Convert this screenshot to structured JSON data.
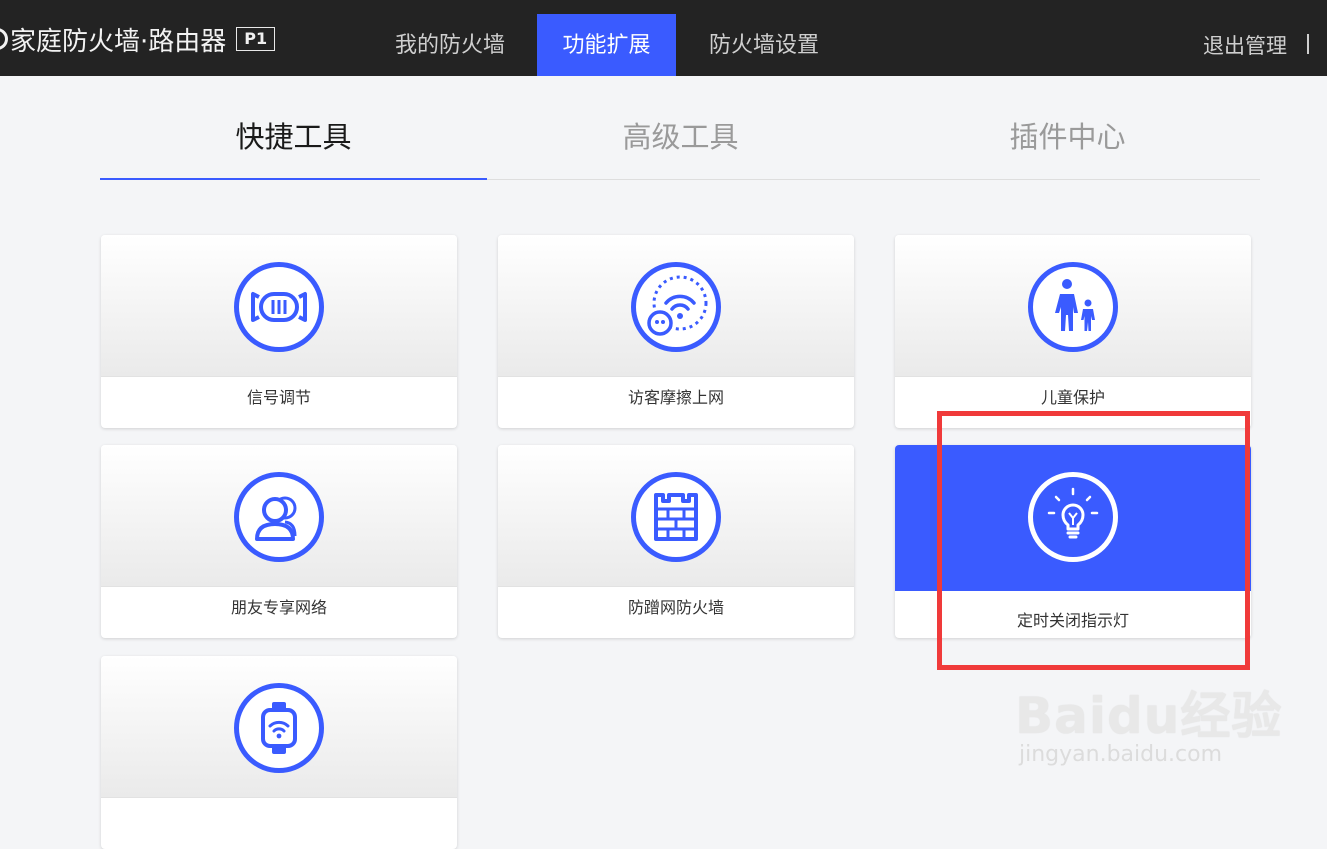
{
  "header": {
    "brand_title": "家庭防火墙·路由器",
    "model_badge": "P1",
    "tabs": [
      {
        "label": "我的防火墙"
      },
      {
        "label": "功能扩展"
      },
      {
        "label": "防火墙设置"
      }
    ],
    "active_tab": "功能扩展",
    "logout_label": "退出管理"
  },
  "subtabs": [
    {
      "label": "快捷工具"
    },
    {
      "label": "高级工具"
    },
    {
      "label": "插件中心"
    }
  ],
  "active_subtab": "快捷工具",
  "tools": [
    {
      "label": "信号调节",
      "icon": "signal-adjust-icon"
    },
    {
      "label": "访客摩擦上网",
      "icon": "guest-wifi-icon"
    },
    {
      "label": "儿童保护",
      "icon": "child-protection-icon"
    },
    {
      "label": "朋友专享网络",
      "icon": "friends-network-icon"
    },
    {
      "label": "防蹭网防火墙",
      "icon": "firewall-wall-icon"
    },
    {
      "label": "定时关闭指示灯",
      "icon": "lightbulb-icon"
    },
    {
      "label": "",
      "icon": "wifi-watch-icon"
    }
  ],
  "selected_tool": "定时关闭指示灯",
  "watermark": {
    "brand": "Baidu经验",
    "url": "jingyan.baidu.com"
  },
  "colors": {
    "accent": "#3a5bff",
    "topbar": "#232323",
    "highlight": "#f03a3a"
  }
}
